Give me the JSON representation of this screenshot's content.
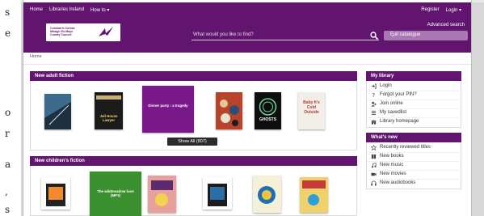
{
  "left_crop": [
    "s",
    "e",
    "o",
    "r",
    "a",
    ",",
    "s"
  ],
  "nav": {
    "items": [
      "Home",
      "Libraries Ireland",
      "How to ▾"
    ],
    "right": [
      "Register",
      "Login ▾"
    ]
  },
  "logo": {
    "text": "Comhairle Contae Mhaigh Eo Mayo County Council"
  },
  "search": {
    "advanced": "Advanced search",
    "placeholder": "What would you like to find?",
    "catalogue": "Full catalogue"
  },
  "breadcrumb": "Home",
  "adult": {
    "heading": "New adult fiction",
    "books": [
      {
        "title": "",
        "color": "#2c4a66"
      },
      {
        "title": "Jail House Lawyer",
        "color": "#1b1b1b"
      },
      {
        "title": "Dinner party : a tragedy",
        "color": "#7a1a8a"
      },
      {
        "title": "",
        "color": "#c2562f"
      },
      {
        "title": "GHOSTS",
        "color": "#0e0e0e"
      },
      {
        "title": "Baby It's Cold Outside",
        "color": "#f1efe8"
      }
    ],
    "show_all": "Show All (807)"
  },
  "children": {
    "heading": "New children's fiction",
    "books": [
      {
        "title": "",
        "color": "#333333"
      },
      {
        "title": "The wildmeadow hare (MP3)",
        "color": "#3a8f2e"
      },
      {
        "title": "",
        "color": "#e9a3a0"
      },
      {
        "title": "",
        "color": "#2b2b2b"
      },
      {
        "title": "",
        "color": "#1f6fb8"
      },
      {
        "title": "",
        "color": "#c73a3a"
      }
    ]
  },
  "library": {
    "heading": "My library",
    "items": [
      {
        "label": "Login",
        "icon": "login-icon"
      },
      {
        "label": "Forgot your PIN?",
        "icon": "question-icon"
      },
      {
        "label": "Join online",
        "icon": "user-plus-icon"
      },
      {
        "label": "My savedlist",
        "icon": "list-icon"
      },
      {
        "label": "Library homepage",
        "icon": "building-icon"
      }
    ]
  },
  "whatsnew": {
    "heading": "What's new",
    "items": [
      {
        "label": "Recently reviewed titles",
        "icon": "star-icon"
      },
      {
        "label": "New books",
        "icon": "book-icon"
      },
      {
        "label": "New music",
        "icon": "music-icon"
      },
      {
        "label": "New movies",
        "icon": "film-icon"
      },
      {
        "label": "New audiobooks",
        "icon": "headphones-icon"
      }
    ]
  },
  "colors": {
    "brand": "#62156f",
    "accent": "#a877b4"
  }
}
